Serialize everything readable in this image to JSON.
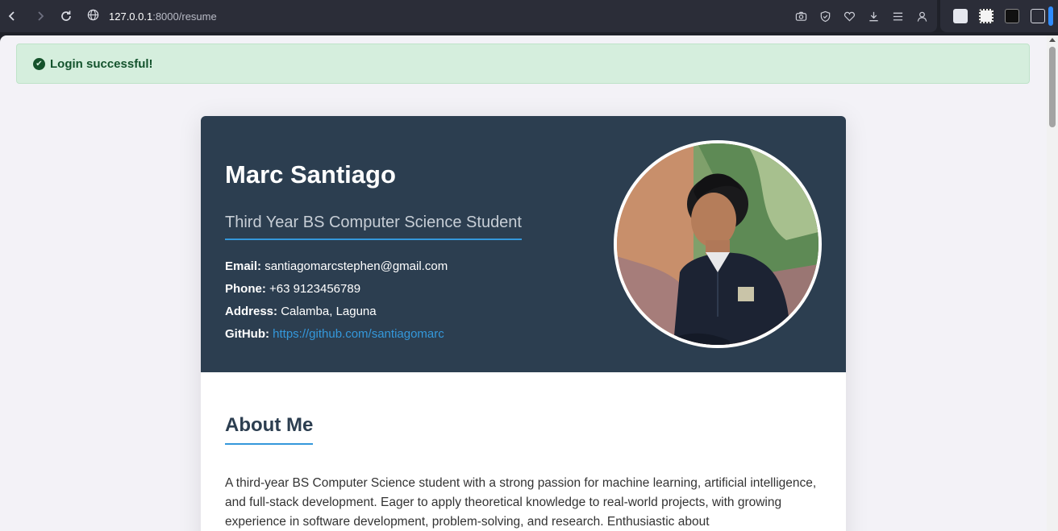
{
  "browser": {
    "url_host": "127.0.0.1",
    "url_path": ":8000/resume"
  },
  "alert": {
    "message": "Login successful!"
  },
  "resume": {
    "name": "Marc Santiago",
    "title": "Third Year BS Computer Science Student",
    "contact": {
      "email_label": "Email:",
      "email": "santiagomarcstephen@gmail.com",
      "phone_label": "Phone:",
      "phone": "+63 9123456789",
      "address_label": "Address:",
      "address": "Calamba, Laguna",
      "github_label": "GitHub:",
      "github": "https://github.com/santiagomarc"
    },
    "about_title": "About Me",
    "about_text": "A third-year BS Computer Science student with a strong passion for machine learning, artificial intelligence, and full-stack development. Eager to apply theoretical knowledge to real-world projects, with growing experience in software development, problem-solving, and research. Enthusiastic about"
  },
  "colors": {
    "header_bg": "#2c3e50",
    "accent": "#3498db",
    "alert_bg": "#d5eedd",
    "alert_text": "#14532d"
  },
  "icons": [
    "back-icon",
    "forward-icon",
    "reload-icon",
    "globe-icon",
    "camera-icon",
    "shield-icon",
    "heart-icon",
    "download-icon",
    "menu-icon",
    "profile-icon",
    "check-circle-icon"
  ]
}
